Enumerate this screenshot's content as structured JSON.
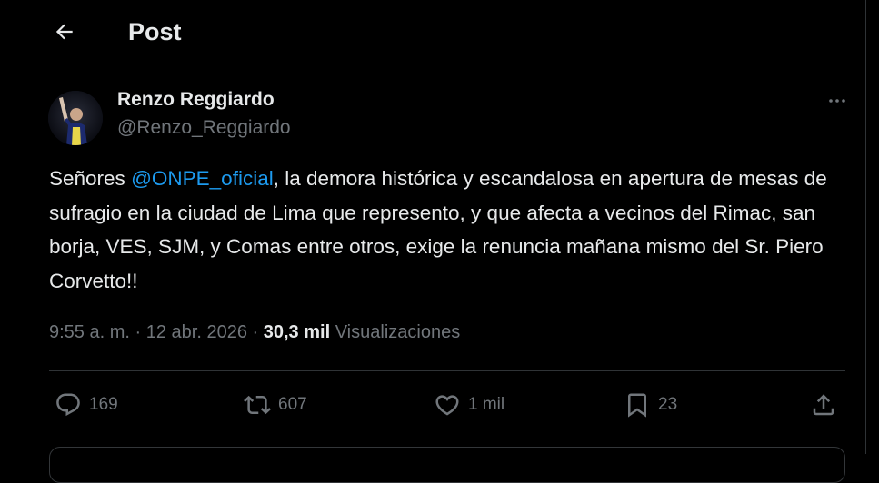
{
  "header": {
    "title": "Post",
    "back_icon": "arrow-left-icon"
  },
  "author": {
    "name": "Renzo Reggiardo",
    "handle": "@Renzo_Reggiardo",
    "avatar_icon": "avatar"
  },
  "tweet": {
    "text_before": "Señores ",
    "mention": "@ONPE_oficial",
    "text_after": ", la demora histórica y escandalosa en apertura de mesas de sufragio en la ciudad de Lima que represento, y que afecta a vecinos del  Rimac, san borja, VES, SJM,  y Comas entre otros, exige la renuncia mañana mismo del Sr. Piero Corvetto!!"
  },
  "meta": {
    "time": "9:55 a. m.",
    "separator": "·",
    "date": "12 abr. 2026",
    "views_count": "30,3 mil",
    "views_label": "Visualizaciones"
  },
  "actions": {
    "replies": "169",
    "reposts": "607",
    "likes": "1 mil",
    "bookmarks": "23"
  },
  "colors": {
    "background": "#000000",
    "text": "#e7e9ea",
    "muted": "#71767b",
    "accent": "#1d9bf0",
    "border": "#2f3336"
  }
}
